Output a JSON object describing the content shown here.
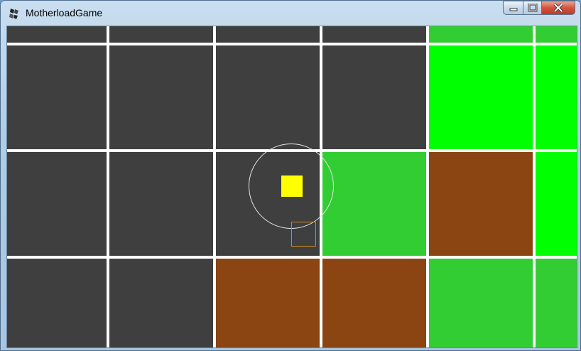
{
  "window": {
    "title": "MotherloadGame",
    "icon": "motherload-app-icon",
    "buttons": {
      "minimize": "minimize-icon",
      "maximize": "maximize-icon",
      "close": "close-icon"
    }
  },
  "tile_colors": {
    "empty": "#3f3f3f",
    "grass": "#32cd32",
    "mineral": "#00ff00",
    "dirt": "#8b4513",
    "grid_line": "#ffffff",
    "player": "#ffff00",
    "ring": "#e6e6e6",
    "target": "#d08a1e"
  },
  "tile_map": [
    [
      "empty",
      "empty",
      "empty",
      "empty",
      "grass",
      "grass"
    ],
    [
      "empty",
      "empty",
      "empty",
      "empty",
      "mineral",
      "mineral"
    ],
    [
      "empty",
      "empty",
      "empty",
      "grass",
      "dirt",
      "mineral"
    ],
    [
      "empty",
      "empty",
      "dirt",
      "dirt",
      "grass",
      "grass"
    ]
  ]
}
